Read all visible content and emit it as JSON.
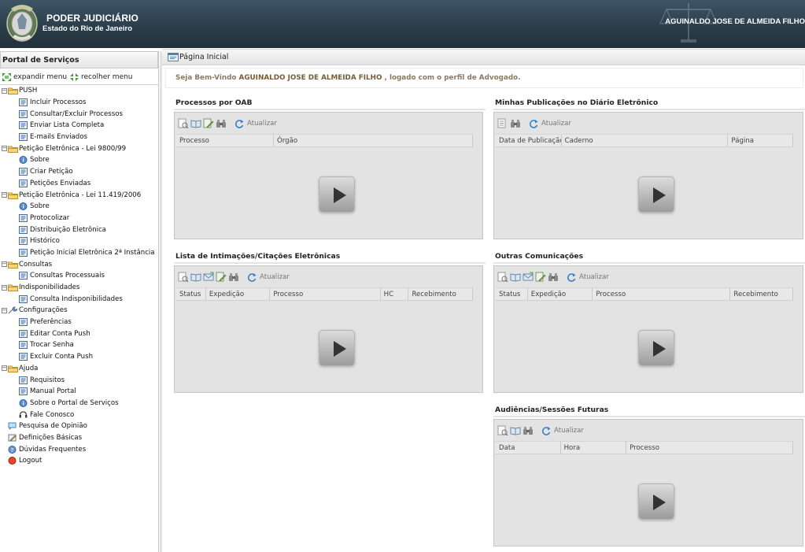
{
  "header": {
    "title": "PODER JUDICIÁRIO",
    "subtitle": "Estado do Rio de Janeiro",
    "user": "AGUINALDO JOSE DE ALMEIDA FILHO"
  },
  "sidebar": {
    "title": "Portal de Serviços",
    "expand_label": "expandir menu",
    "collapse_label": "recolher menu",
    "groups": [
      {
        "label": "PUSH",
        "items": [
          "Incluir Processos",
          "Consultar/Excluir Processos",
          "Enviar Lista Completa",
          "E-mails Enviados"
        ]
      },
      {
        "label": "Petição Eletrônica - Lei 9800/99",
        "items": [
          "Sobre",
          "Criar Petição",
          "Petições Enviadas"
        ]
      },
      {
        "label": "Petição Eletrônica - Lei 11.419/2006",
        "items": [
          "Sobre",
          "Protocolizar",
          "Distribuição Eletrônica",
          "Histórico",
          "Petição Inicial Eletrônica 2ª Instância"
        ]
      },
      {
        "label": "Consultas",
        "items": [
          "Consultas Processuais"
        ]
      },
      {
        "label": "Indisponibilidades",
        "items": [
          "Consulta Indisponibilidades"
        ]
      },
      {
        "label": "Configurações",
        "items": [
          "Preferências",
          "Editar Conta Push",
          "Trocar Senha",
          "Excluir Conta Push"
        ]
      },
      {
        "label": "Ajuda",
        "items": [
          "Requisitos",
          "Manual Portal",
          "Sobre o Portal de Serviços",
          "Fale Conosco"
        ]
      }
    ],
    "root_items": [
      "Pesquisa de Opinião",
      "Definições Básicas",
      "Dúvidas Frequentes",
      "Logout"
    ]
  },
  "breadcrumb": "Página Inicial",
  "welcome": {
    "prefix": "Seja Bem-Vindo",
    "name": "AGUINALDO JOSE DE ALMEIDA FILHO",
    "suffix": ", logado com o perfil de Advogado."
  },
  "refresh_label": "Atualizar",
  "panels": {
    "oab": {
      "title": "Processos por OAB",
      "columns": [
        "Processo",
        "Órgão"
      ]
    },
    "publicacoes": {
      "title": "Minhas Publicações no Diário Eletrônico",
      "columns": [
        "Data de Publicação",
        "Caderno",
        "Página"
      ]
    },
    "intimacoes": {
      "title": "Lista de Intimações/Citações Eletrônicas",
      "columns": [
        "Status",
        "Expedição",
        "Processo",
        "HC",
        "Recebimento"
      ]
    },
    "comunicacoes": {
      "title": "Outras Comunicações",
      "columns": [
        "Status",
        "Expedição",
        "Processo",
        "Recebimento"
      ]
    },
    "audiencias": {
      "title": "Audiências/Sessões Futuras",
      "columns": [
        "Data",
        "Hora",
        "Processo"
      ]
    }
  }
}
